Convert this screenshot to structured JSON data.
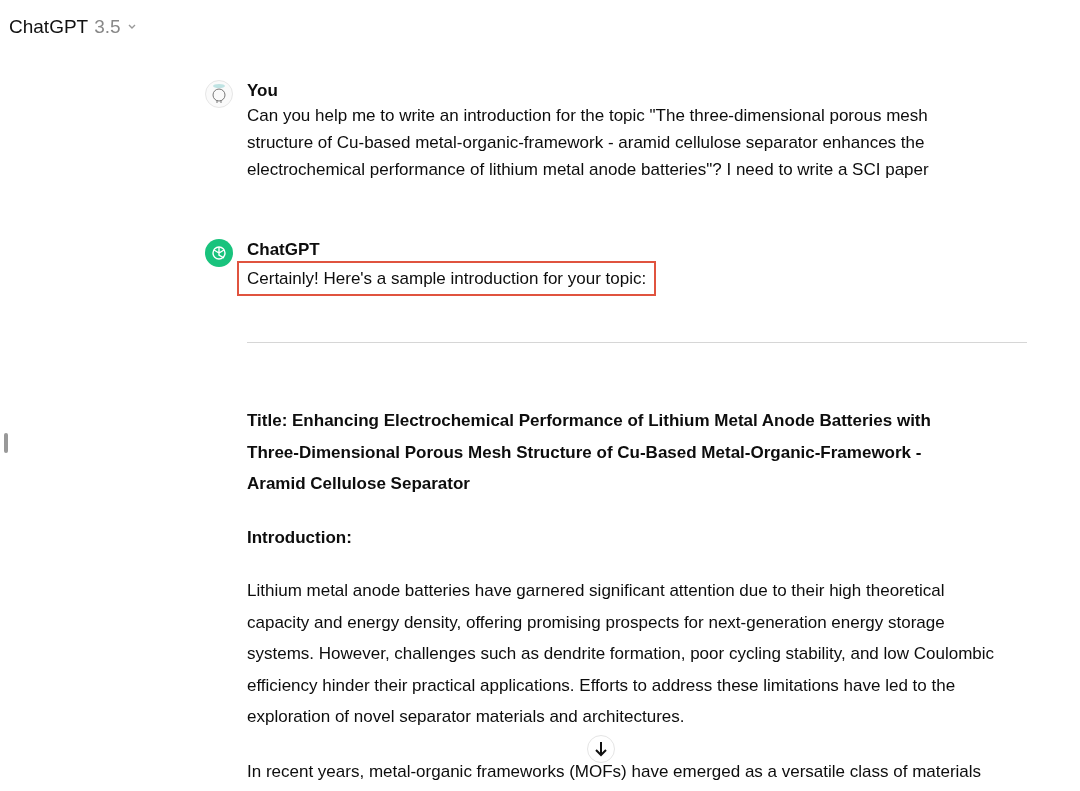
{
  "header": {
    "model_name": "ChatGPT",
    "version": "3.5"
  },
  "messages": [
    {
      "kind": "user",
      "author": "You",
      "text": "Can you help me to write an introduction for the topic \"The three-dimensional porous mesh structure of Cu-based metal-organic-framework - aramid cellulose separator enhances the electrochemical performance of lithium metal anode batteries\"? I need to write a SCI paper",
      "highlighted": false
    },
    {
      "kind": "assistant",
      "author": "ChatGPT",
      "text": "Certainly! Here's a sample introduction for your topic:",
      "highlighted": true
    }
  ],
  "article": {
    "title": "Title: Enhancing Electrochemical Performance of Lithium Metal Anode Batteries with Three-Dimensional Porous Mesh Structure of Cu-Based Metal-Organic-Framework - Aramid Cellulose Separator",
    "heading": "Introduction:",
    "paragraphs": [
      "Lithium metal anode batteries have garnered significant attention due to their high theoretical capacity and energy density, offering promising prospects for next-generation energy storage systems. However, challenges such as dendrite formation, poor cycling stability, and low Coulombic efficiency hinder their practical applications. Efforts to address these limitations have led to the exploration of novel separator materials and architectures.",
      "In recent years, metal-organic frameworks (MOFs) have emerged as a versatile class of materials"
    ]
  }
}
